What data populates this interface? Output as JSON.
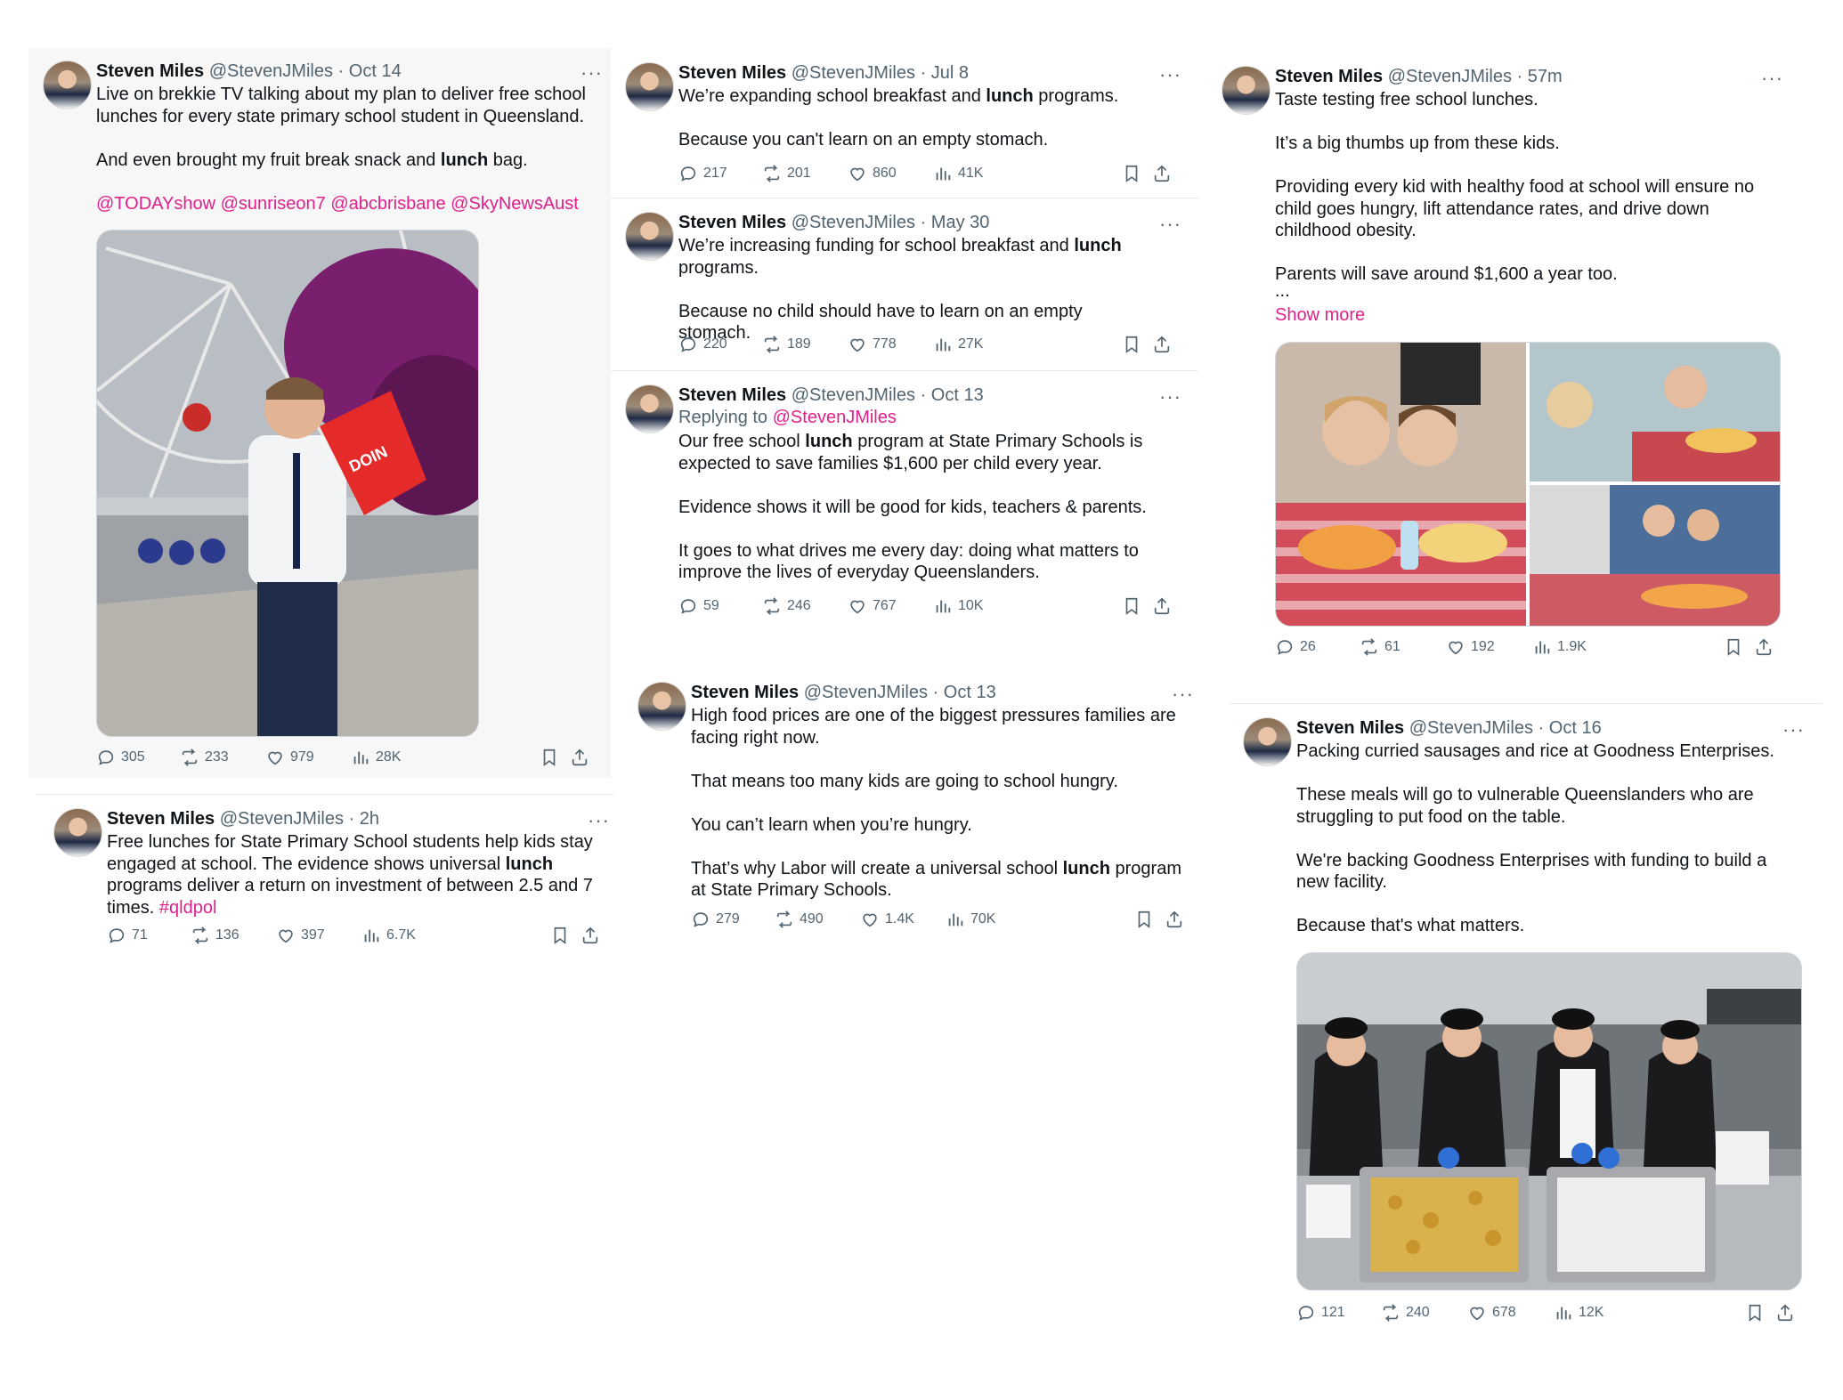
{
  "tweets": [
    {
      "id": "t1",
      "name": "Steven Miles",
      "handle": "@StevenJMiles",
      "time": "Oct 14",
      "paragraphs": [
        [
          "Live on brekkie TV talking about my plan to deliver free school lunches for every state primary school student in Queensland."
        ],
        [
          "And even brought my fruit break snack and ",
          {
            "b": "lunch"
          },
          " bag."
        ],
        [
          {
            "link": "@TODAYshow"
          },
          " ",
          {
            "link": "@sunriseon7"
          },
          " ",
          {
            "link": "@abcbrisbane"
          },
          " ",
          {
            "link": "@SkyNewsAust"
          }
        ]
      ],
      "stats": {
        "replies": "305",
        "reposts": "233",
        "likes": "979",
        "views": "28K"
      },
      "media": {
        "description": "man-with-apple-and-red-bag"
      }
    },
    {
      "id": "t2",
      "name": "Steven Miles",
      "handle": "@StevenJMiles",
      "time": "2h",
      "paragraphs": [
        [
          "Free lunches for State Primary School students help kids stay engaged at school. The evidence shows universal ",
          {
            "b": "lunch"
          },
          " programs deliver a return on investment of between 2.5 and 7 times. ",
          {
            "link": "#qldpol"
          }
        ]
      ],
      "stats": {
        "replies": "71",
        "reposts": "136",
        "likes": "397",
        "views": "6.7K"
      }
    },
    {
      "id": "t3",
      "name": "Steven Miles",
      "handle": "@StevenJMiles",
      "time": "Jul 8",
      "paragraphs": [
        [
          "We’re expanding school breakfast and ",
          {
            "b": "lunch"
          },
          " programs."
        ],
        [
          "Because you can't learn on an empty stomach."
        ]
      ],
      "stats": {
        "replies": "217",
        "reposts": "201",
        "likes": "860",
        "views": "41K"
      }
    },
    {
      "id": "t4",
      "name": "Steven Miles",
      "handle": "@StevenJMiles",
      "time": "May 30",
      "paragraphs": [
        [
          "We’re increasing funding for school breakfast and ",
          {
            "b": "lunch"
          },
          " programs."
        ],
        [
          "Because no child should have to learn on an empty stomach."
        ]
      ],
      "stats": {
        "replies": "220",
        "reposts": "189",
        "likes": "778",
        "views": "27K"
      }
    },
    {
      "id": "t5",
      "name": "Steven Miles",
      "handle": "@StevenJMiles",
      "time": "Oct 13",
      "reply_prefix": "Replying to ",
      "reply_to": "@StevenJMiles",
      "paragraphs": [
        [
          "Our free school ",
          {
            "b": "lunch"
          },
          " program at State Primary Schools is expected to save families $1,600 per child every year."
        ],
        [
          "Evidence shows it will be good for kids, teachers & parents."
        ],
        [
          "It goes to what drives me every day: doing what matters to improve the lives of everyday Queenslanders."
        ]
      ],
      "stats": {
        "replies": "59",
        "reposts": "246",
        "likes": "767",
        "views": "10K"
      }
    },
    {
      "id": "t6",
      "name": "Steven Miles",
      "handle": "@StevenJMiles",
      "time": "Oct 13",
      "paragraphs": [
        [
          "High food prices are one of the biggest pressures families are facing right now."
        ],
        [
          "That means too many kids are going to school hungry."
        ],
        [
          "You can’t learn when you’re hungry."
        ],
        [
          "That’s why Labor will create a universal school ",
          {
            "b": "lunch"
          },
          " program at State Primary Schools."
        ]
      ],
      "stats": {
        "replies": "279",
        "reposts": "490",
        "likes": "1.4K",
        "views": "70K"
      }
    },
    {
      "id": "t7",
      "name": "Steven Miles",
      "handle": "@StevenJMiles",
      "time": "57m",
      "paragraphs": [
        [
          "Taste testing free school lunches."
        ],
        [
          "It’s a big thumbs up from these kids."
        ],
        [
          "Providing every kid with healthy food at school will ensure no child goes hungry, lift attendance rates, and drive down childhood obesity."
        ],
        [
          "Parents will save around $1,600 a year too."
        ]
      ],
      "ellipsis": "...",
      "show_more": "Show more",
      "stats": {
        "replies": "26",
        "reposts": "61",
        "likes": "192",
        "views": "1.9K"
      },
      "media": {
        "description": "kids-eating-lunch-collage"
      }
    },
    {
      "id": "t8",
      "name": "Steven Miles",
      "handle": "@StevenJMiles",
      "time": "Oct 16",
      "paragraphs": [
        [
          "Packing curried sausages and rice at Goodness Enterprises."
        ],
        [
          "These meals will go to vulnerable Queenslanders who are struggling to put food on the table."
        ],
        [
          "We're backing Goodness Enterprises with funding to build a new facility."
        ],
        [
          "Because that's what matters."
        ]
      ],
      "stats": {
        "replies": "121",
        "reposts": "240",
        "likes": "678",
        "views": "12K"
      },
      "media": {
        "description": "kitchen-packing-meals"
      }
    }
  ],
  "colors": {
    "link": "#e0218a",
    "muted": "#536471",
    "text": "#0f1419"
  }
}
